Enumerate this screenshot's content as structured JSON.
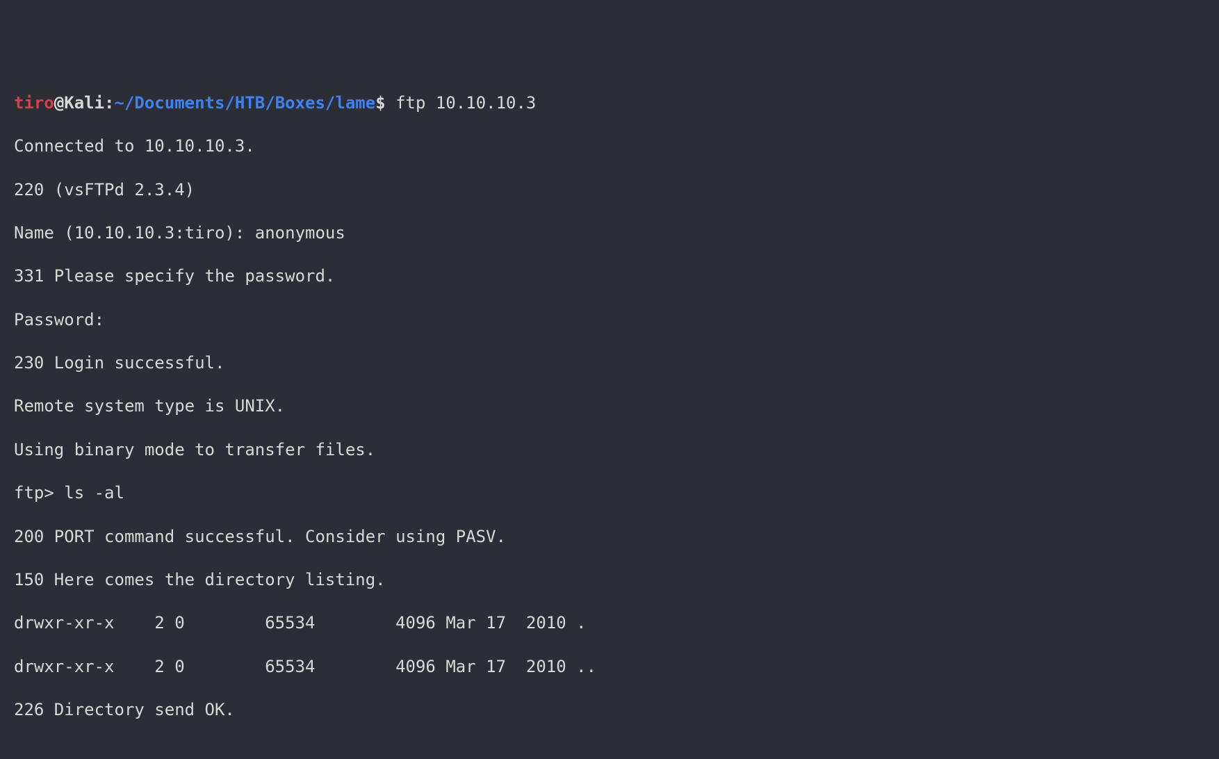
{
  "prompt": {
    "user": "tiro",
    "at": "@",
    "host": "Kali",
    "colon": ":",
    "path": "~/Documents/HTB/Boxes/lame",
    "dollar": "$ ",
    "command": "ftp 10.10.10.3"
  },
  "lines": {
    "l1": "Connected to 10.10.10.3.",
    "l2": "220 (vsFTPd 2.3.4)",
    "l3": "Name (10.10.10.3:tiro): anonymous",
    "l4": "331 Please specify the password.",
    "l5": "Password:",
    "l6": "230 Login successful.",
    "l7": "Remote system type is UNIX.",
    "l8": "Using binary mode to transfer files.",
    "l9": "ftp> ls -al",
    "l10": "200 PORT command successful. Consider using PASV.",
    "l11": "150 Here comes the directory listing.",
    "l12": "drwxr-xr-x    2 0        65534        4096 Mar 17  2010 .",
    "l13": "drwxr-xr-x    2 0        65534        4096 Mar 17  2010 ..",
    "l14": "226 Directory send OK."
  }
}
